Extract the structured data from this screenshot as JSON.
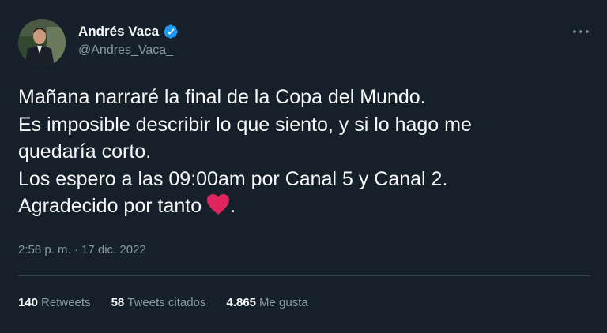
{
  "author": {
    "name": "Andrés Vaca",
    "handle": "@Andres_Vaca_",
    "verified": true
  },
  "tweet": {
    "lines": [
      "Mañana narraré la final de la Copa del Mundo.",
      "Es imposible describir lo que siento, y si lo hago me",
      "quedaría corto.",
      "Los espero a las 09:00am por Canal 5 y Canal 2.",
      "Agradecido por tanto"
    ],
    "trailing": ".",
    "timestamp": "2:58 p. m. · 17 dic. 2022"
  },
  "stats": {
    "retweets": {
      "count": "140",
      "label": "Retweets"
    },
    "quotes": {
      "count": "58",
      "label": "Tweets citados"
    },
    "likes": {
      "count": "4.865",
      "label": "Me gusta"
    }
  },
  "icons": {
    "verified": "verified-badge-icon",
    "more": "more-options-icon",
    "heart": "red-heart-emoji"
  },
  "colors": {
    "background": "#15202b",
    "verified": "#1d9bf0",
    "heart": "#e0245e",
    "secondary_text": "#8b98a5"
  }
}
